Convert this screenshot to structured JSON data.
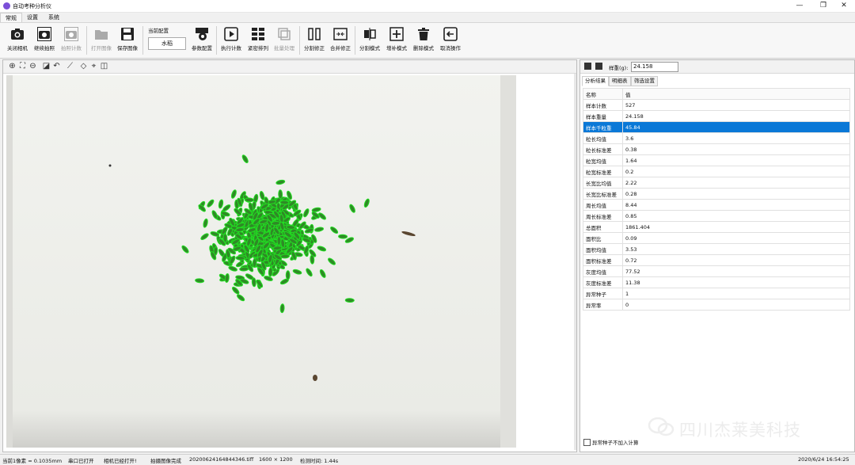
{
  "window": {
    "title": "自动考种分析仪",
    "icon": "purple-circle-app-icon"
  },
  "window_controls": {
    "minimize": "—",
    "maximize": "❐",
    "close": "✕"
  },
  "menu_tabs": [
    "常规",
    "设置",
    "系统"
  ],
  "toolbar": {
    "close_camera": "关闭相机",
    "continuous_shoot": "继续拍照",
    "shoot_count": "拍照计数",
    "open_image": "打开图像",
    "save_image": "保存图像",
    "config_label": "当前配置",
    "config_value": "水稻",
    "param_config": "参数配置",
    "execute_count": "执行计数",
    "tight_arrange": "紧密排列",
    "batch_process": "批量处理",
    "split_correct": "分割修正",
    "merge_correct": "合并修正",
    "split_mode": "分割模式",
    "add_mode": "增补模式",
    "delete_mode": "删除模式",
    "cancel_operation": "取消操作"
  },
  "image_tools": [
    "zoom-in-icon",
    "fit-icon",
    "zoom-out-icon",
    "crop-icon",
    "undo-icon",
    "ruler-icon",
    "diamond-icon",
    "center-icon",
    "split-view-icon"
  ],
  "right_panel": {
    "weight_label": "样重(g):",
    "weight_value": "24.158",
    "tabs": [
      "分析结果",
      "明细表",
      "筛选设置"
    ],
    "table_headers": [
      "名称",
      "值"
    ],
    "rows": [
      {
        "name": "样本计数",
        "value": "527"
      },
      {
        "name": "样本重量",
        "value": "24.158"
      },
      {
        "name": "样本千粒重",
        "value": "45.84"
      },
      {
        "name": "粒长均值",
        "value": "3.6"
      },
      {
        "name": "粒长标准差",
        "value": "0.38"
      },
      {
        "name": "粒宽均值",
        "value": "1.64"
      },
      {
        "name": "粒宽标准差",
        "value": "0.2"
      },
      {
        "name": "长宽比均值",
        "value": "2.22"
      },
      {
        "name": "长宽比标准差",
        "value": "0.28"
      },
      {
        "name": "周长均值",
        "value": "8.44"
      },
      {
        "name": "周长标准差",
        "value": "0.85"
      },
      {
        "name": "总面积",
        "value": "1861.404"
      },
      {
        "name": "面积比",
        "value": "0.09"
      },
      {
        "name": "面积均值",
        "value": "3.53"
      },
      {
        "name": "面积标准差",
        "value": "0.72"
      },
      {
        "name": "灰度均值",
        "value": "77.52"
      },
      {
        "name": "灰度标准差",
        "value": "11.38"
      },
      {
        "name": "异常种子",
        "value": "1"
      },
      {
        "name": "异常率",
        "value": "0"
      }
    ],
    "selected_row": 2,
    "exclude_checkbox_label": "异常种子不加入计算"
  },
  "watermark": "四川杰莱美科技",
  "status_bar": {
    "pixel": "当前1像素 = 0.1035mm",
    "serial": "串口已打开",
    "camera": "相机已经打开!",
    "capture": "拍摄图像完成",
    "file": "20200624164844346.tiff",
    "resolution": "1600 × 1200",
    "detect_time": "检测时间: 1.44s",
    "datetime": "2020/6/24 16:54:25"
  },
  "colors": {
    "accent": "#0a78d7",
    "seed_outline": "#22dd22",
    "seed_body": "#2f8a26"
  }
}
